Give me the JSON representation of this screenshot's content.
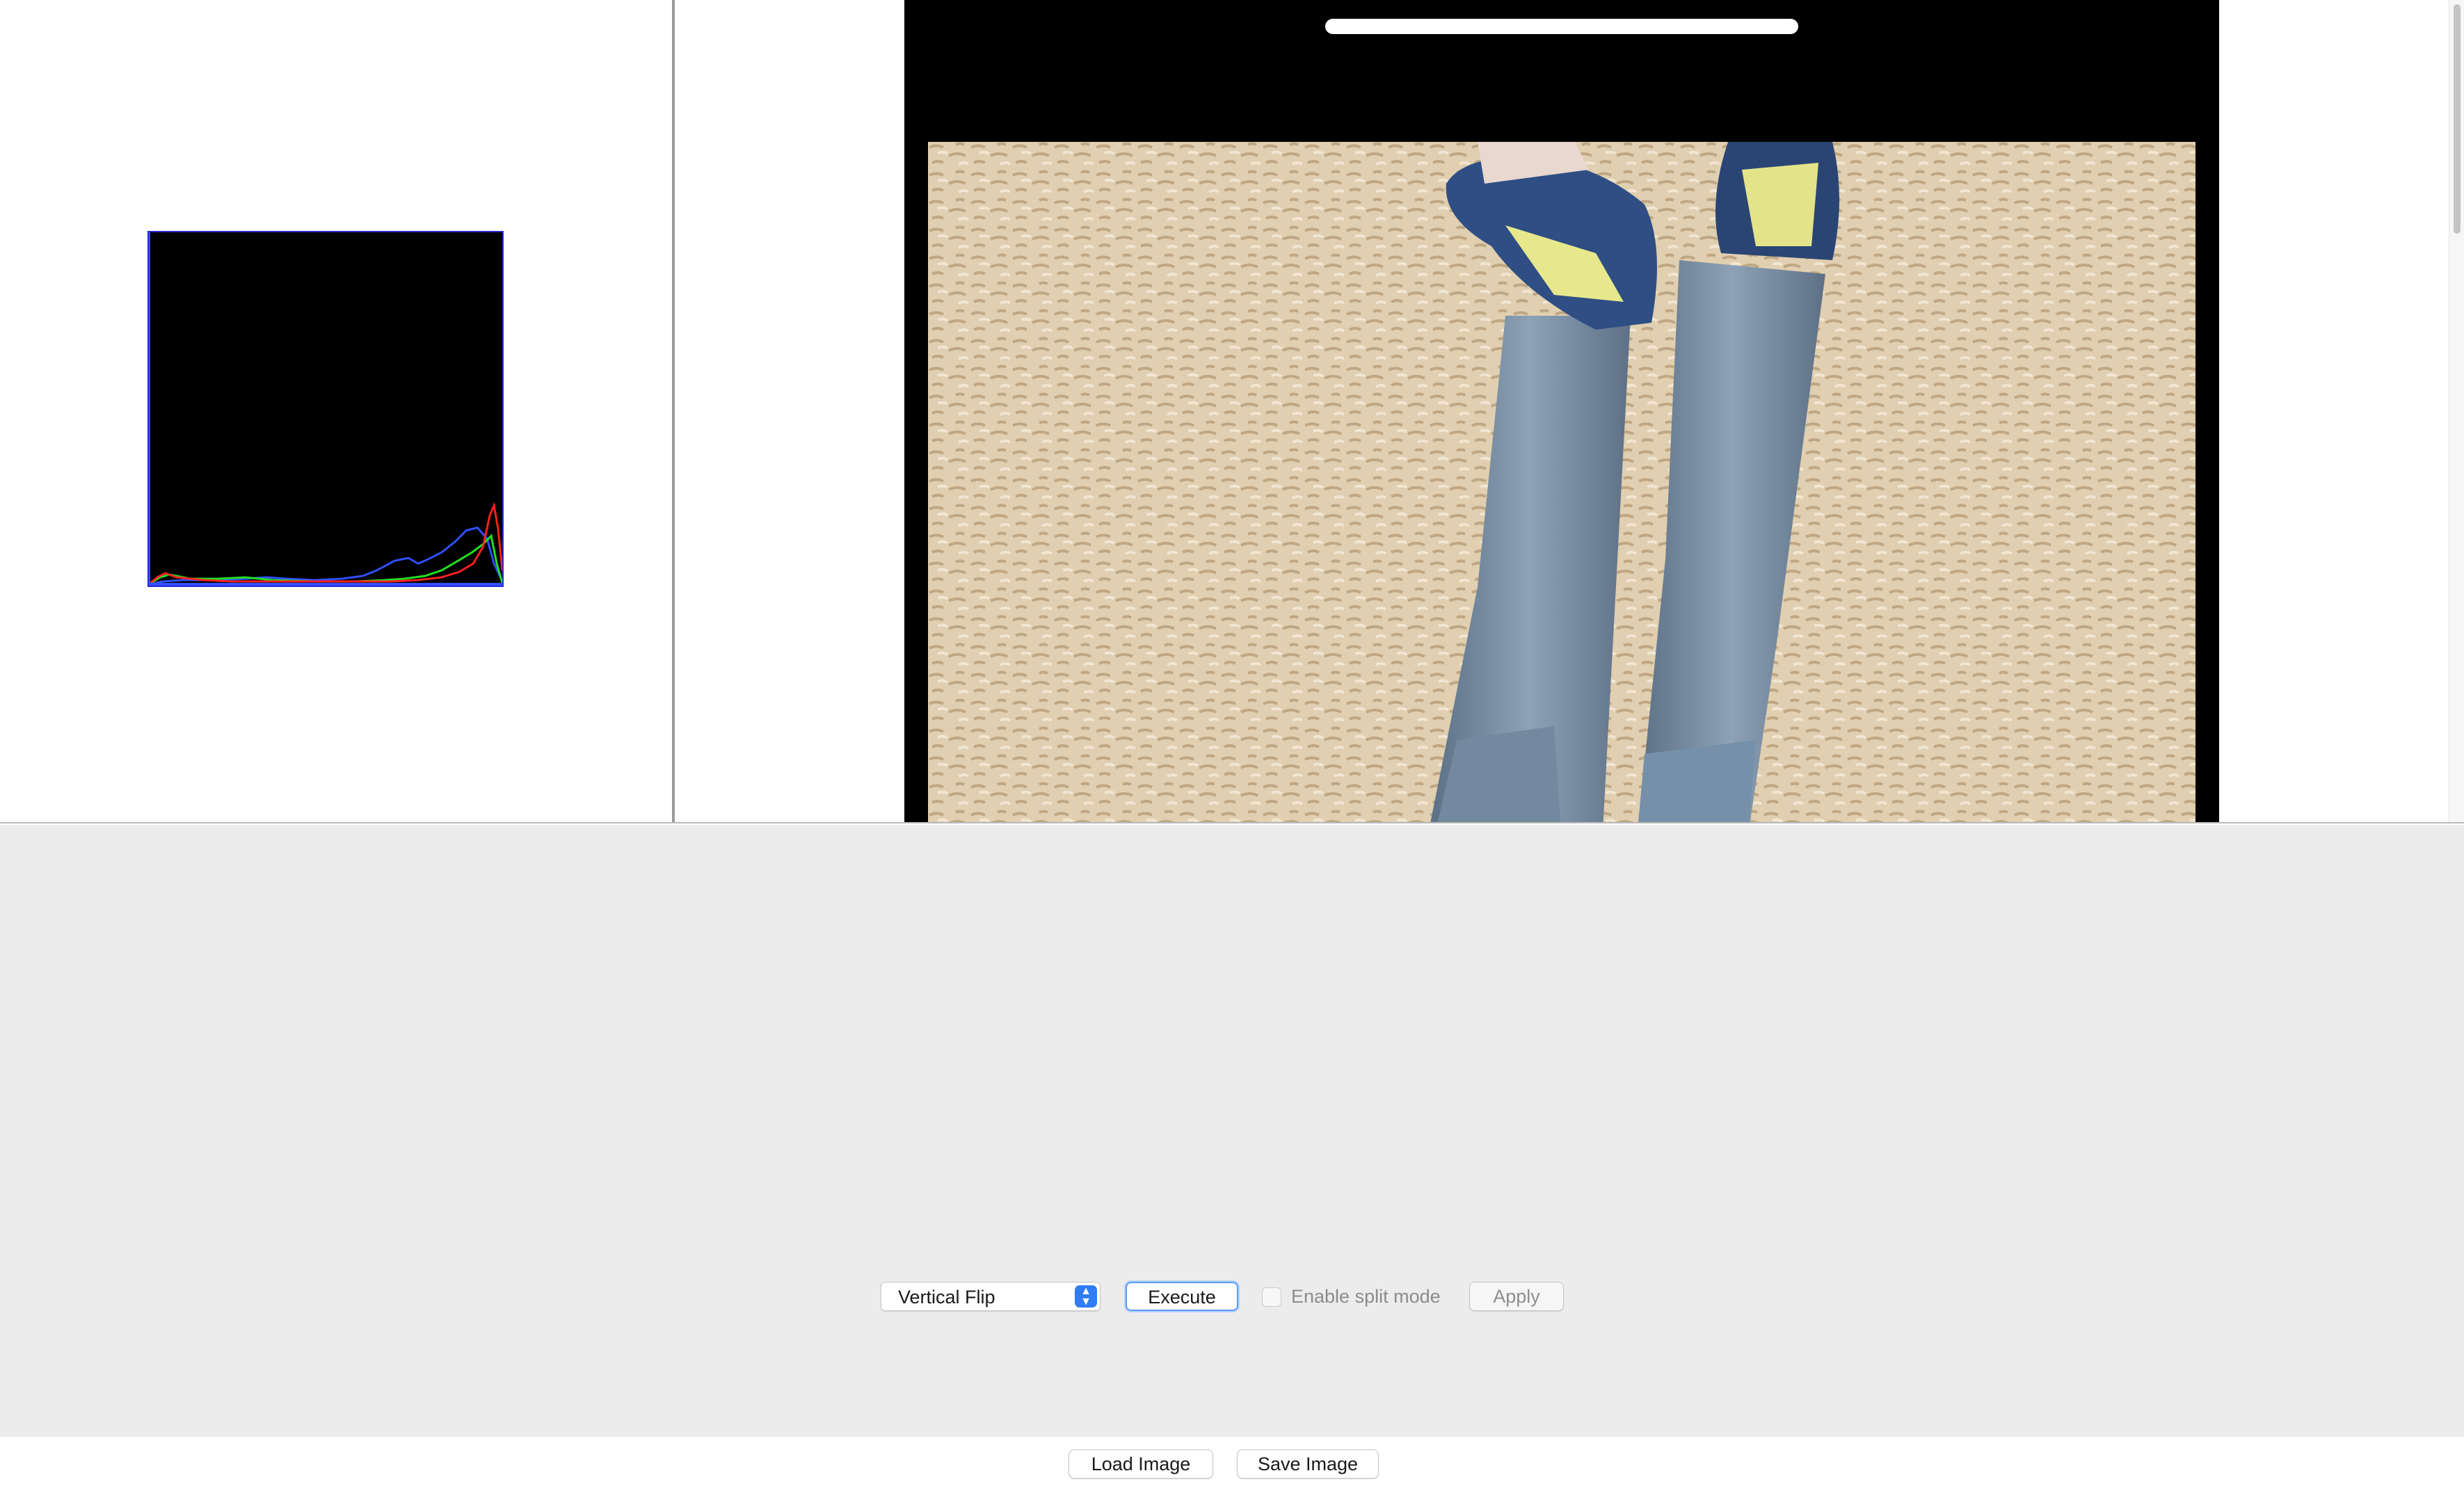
{
  "histogram": {
    "colors": {
      "red": "#ff2020",
      "green": "#20e020",
      "blue": "#3050ff"
    }
  },
  "controls": {
    "operation_select": {
      "value": "Vertical Flip"
    },
    "execute_label": "Execute",
    "split_mode_label": "Enable split mode",
    "split_mode_checked": false,
    "apply_label": "Apply"
  },
  "footer": {
    "load_label": "Load Image",
    "save_label": "Save Image"
  },
  "colors": {
    "accent": "#2f7cf6",
    "panel_bg": "#ececec"
  }
}
